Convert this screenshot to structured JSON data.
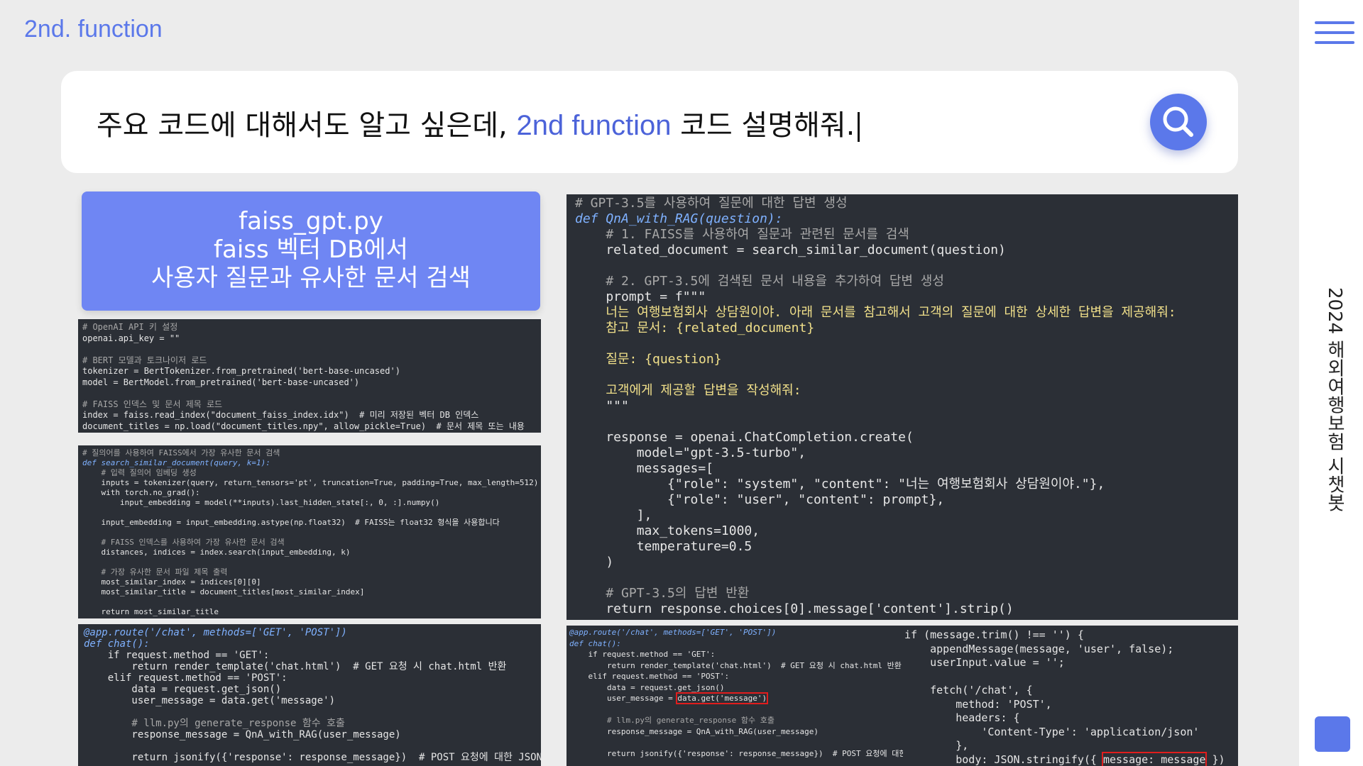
{
  "brand": "2nd. function",
  "sidebar_title": "2024 해외여행보험 시챗봇",
  "search": {
    "query_prefix": "주요 코드에 대해서도 알고 싶은데, ",
    "query_highlight": "2nd function",
    "query_suffix": " 코드 설명해줘."
  },
  "callout": {
    "line1": "faiss_gpt.py",
    "line2": "faiss 벡터 DB에서",
    "line3": "사용자 질문과 유사한 문서 검색"
  },
  "icons": {
    "search": "search-icon",
    "menu": "hamburger-menu-icon"
  },
  "colors": {
    "accent": "#5b78ea",
    "code_bg": "#2b2f36",
    "highlight_red": "#e11d1d"
  },
  "code1": [
    "# OpenAI API 키 설정",
    "openai.api_key = \"\"",
    "",
    "# BERT 모델과 토크나이저 로드",
    "tokenizer = BertTokenizer.from_pretrained('bert-base-uncased')",
    "model = BertModel.from_pretrained('bert-base-uncased')",
    "",
    "# FAISS 인덱스 및 문서 제목 로드",
    "index = faiss.read_index(\"document_faiss_index.idx\")  # 미리 저장된 벡터 DB 인덱스",
    "document_titles = np.load(\"document_titles.npy\", allow_pickle=True)  # 문서 제목 또는 내용"
  ],
  "code2": [
    "# 질의어를 사용하여 FAISS에서 가장 유사한 문서 검색",
    "def search_similar_document(query, k=1):",
    "    # 입력 질의어 임베딩 생성",
    "    inputs = tokenizer(query, return_tensors='pt', truncation=True, padding=True, max_length=512)",
    "    with torch.no_grad():",
    "        input_embedding = model(**inputs).last_hidden_state[:, 0, :].numpy()",
    "",
    "    input_embedding = input_embedding.astype(np.float32)  # FAISS는 float32 형식을 사용합니다",
    "",
    "    # FAISS 인덱스를 사용하여 가장 유사한 문서 검색",
    "    distances, indices = index.search(input_embedding, k)",
    "",
    "    # 가장 유사한 문서 파일 제목 출력",
    "    most_similar_index = indices[0][0]",
    "    most_similar_title = document_titles[most_similar_index]",
    "",
    "    return most_similar_title"
  ],
  "code3": [
    "@app.route('/chat', methods=['GET', 'POST'])",
    "def chat():",
    "    if request.method == 'GET':",
    "        return render_template('chat.html')  # GET 요청 시 chat.html 반환",
    "    elif request.method == 'POST':",
    "        data = request.get_json()",
    "        user_message = data.get('message')",
    "",
    "        # llm.py의 generate_response 함수 호출",
    "        response_message = QnA_with_RAG(user_message)",
    "",
    "        return jsonify({'response': response_message})  # POST 요청에 대한 JSON 응답"
  ],
  "code4": [
    "# GPT-3.5를 사용하여 질문에 대한 답변 생성",
    "def QnA_with_RAG(question):",
    "    # 1. FAISS를 사용하여 질문과 관련된 문서를 검색",
    "    related_document = search_similar_document(question)",
    "",
    "    # 2. GPT-3.5에 검색된 문서 내용을 추가하여 답변 생성",
    "    prompt = f\"\"\"",
    "    너는 여행보험회사 상담원이야. 아래 문서를 참고해서 고객의 질문에 대한 상세한 답변을 제공해줘:",
    "    참고 문서: {related_document}",
    "",
    "    질문: {question}",
    "",
    "    고객에게 제공할 답변을 작성해줘:",
    "    \"\"\"",
    "",
    "    response = openai.ChatCompletion.create(",
    "        model=\"gpt-3.5-turbo\",",
    "        messages=[",
    "            {\"role\": \"system\", \"content\": \"너는 여행보험회사 상담원이야.\"},",
    "            {\"role\": \"user\", \"content\": prompt},",
    "        ],",
    "        max_tokens=1000,",
    "        temperature=0.5",
    "    )",
    "",
    "    # GPT-3.5의 답변 반환",
    "    return response.choices[0].message['content'].strip()"
  ],
  "code5": [
    "@app.route('/chat', methods=['GET', 'POST'])",
    "def chat():",
    "    if request.method == 'GET':",
    "        return render_template('chat.html')  # GET 요청 시 chat.html 반환",
    "    elif request.method == 'POST':",
    "        data = request.get_json()",
    "        user_message = ",
    "",
    "        # llm.py의 generate_response 함수 호출",
    "        response_message = QnA_with_RAG(user_message)",
    "",
    "        return jsonify({'response': response_message})  # POST 요청에 대한 JSON 응답"
  ],
  "code5_highlight": "data.get('message')",
  "code6": [
    "if (message.trim() !== '') {",
    "    appendMessage(message, 'user', false);",
    "    userInput.value = '';",
    "",
    "    fetch('/chat', {",
    "        method: 'POST',",
    "        headers: {",
    "            'Content-Type': 'application/json'",
    "        },",
    "        body: JSON.stringify({ "
  ],
  "code6_highlight": "message: message",
  "code6_tail": " })"
}
